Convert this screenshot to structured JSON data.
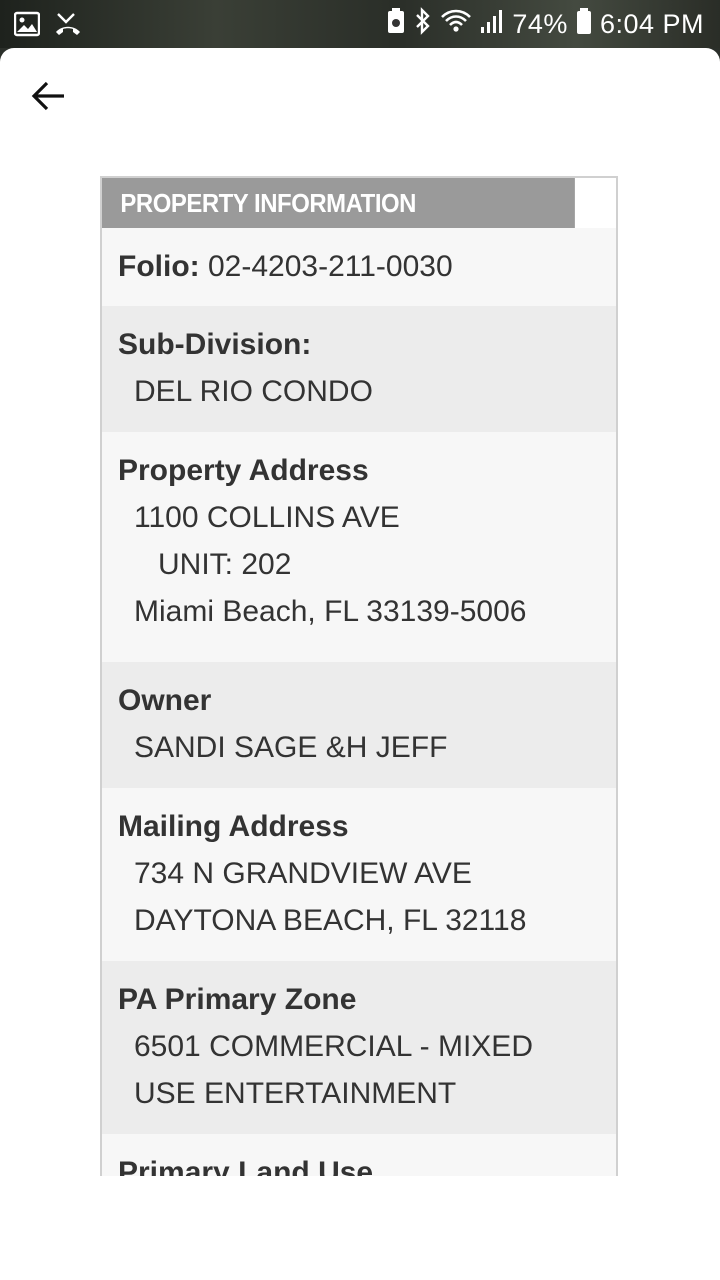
{
  "status_bar": {
    "battery_percent": "74%",
    "time": "6:04 PM",
    "left_icons": [
      "image-icon",
      "missed-call-icon"
    ],
    "right_icons": [
      "battery-saver-icon",
      "bluetooth-icon",
      "wifi-icon",
      "signal-icon",
      "battery-icon"
    ]
  },
  "header": {
    "back_icon": "arrow-left-icon"
  },
  "panel": {
    "title": "PROPERTY INFORMATION",
    "folio": {
      "label": "Folio:",
      "value": "02-4203-211-0030"
    },
    "subdivision": {
      "label": "Sub-Division:",
      "value": "DEL RIO CONDO"
    },
    "property_address": {
      "label": "Property Address",
      "street": "1100 COLLINS AVE",
      "unit": "UNIT:  202",
      "city_line": "Miami Beach, FL  33139-5006"
    },
    "owner": {
      "label": "Owner",
      "value": "SANDI SAGE &H JEFF"
    },
    "mailing_address": {
      "label": "Mailing Address",
      "street": "734 N GRANDVIEW AVE",
      "city_line": "DAYTONA BEACH, FL 32118"
    },
    "primary_zone": {
      "label": "PA Primary Zone",
      "line1": "6501 COMMERCIAL - MIXED",
      "line2": "USE ENTERTAINMENT"
    },
    "primary_land_use": {
      "label": "Primary Land Use"
    }
  },
  "colors": {
    "header_bg": "#9a9a9a",
    "row_light": "#f7f7f7",
    "row_dark": "#ececec",
    "text": "#333333"
  }
}
